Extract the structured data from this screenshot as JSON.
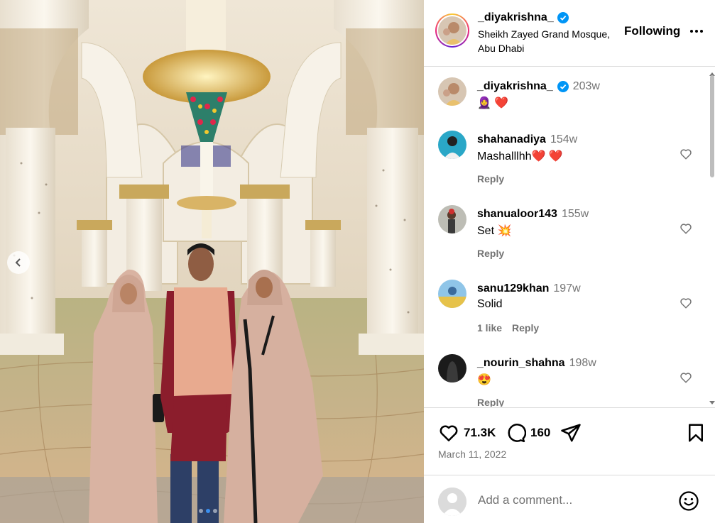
{
  "post": {
    "username": "_diyakrishna_",
    "location": "Sheikh Zayed Grand Mosque, Abu Dhabi",
    "follow_label": "Following",
    "more_icon": "more-horizontal-icon"
  },
  "comments": [
    {
      "username": "_diyakrishna_",
      "time": "203w",
      "text": "🧕 ❤️",
      "verified": true,
      "likes": "",
      "reply": ""
    },
    {
      "username": "shahanadiya",
      "time": "154w",
      "text": "Mashalllhh❤️ ❤️",
      "likes": "",
      "reply": "Reply"
    },
    {
      "username": "shanualoor143",
      "time": "155w",
      "text": "Set 💥",
      "likes": "",
      "reply": "Reply"
    },
    {
      "username": "sanu129khan",
      "time": "197w",
      "text": "Solid",
      "likes": "1 like",
      "reply": "Reply"
    },
    {
      "username": "_nourin_shahna",
      "time": "198w",
      "text": "😍",
      "likes": "",
      "reply": "Reply"
    }
  ],
  "actions": {
    "likes": "71.3K",
    "comments": "160",
    "date": "March 11, 2022"
  },
  "add_comment": {
    "placeholder": "Add a comment..."
  },
  "colors": {
    "verified": "#0095f6",
    "secondary_text": "#737373",
    "border": "#dbdbdb"
  },
  "carousel": {
    "total": 3,
    "current": 2
  }
}
